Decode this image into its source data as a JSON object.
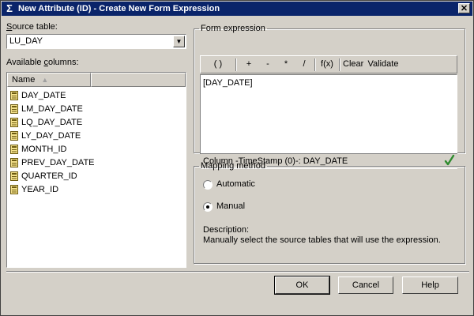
{
  "window": {
    "title": "New Attribute (ID) - Create New Form Expression",
    "icon": "sigma-icon",
    "close_label": "✕"
  },
  "source": {
    "label_prefix": "",
    "label_underline": "S",
    "label_rest": "ource table:",
    "value": "LU_DAY"
  },
  "columns": {
    "label_prefix": "Available ",
    "label_underline": "c",
    "label_rest": "olumns:",
    "header": "Name",
    "items": [
      "DAY_DATE",
      "LM_DAY_DATE",
      "LQ_DAY_DATE",
      "LY_DAY_DATE",
      "MONTH_ID",
      "PREV_DAY_DATE",
      "QUARTER_ID",
      "YEAR_ID"
    ]
  },
  "form_expression": {
    "legend": "Form expression",
    "toolbar": {
      "paren": "( )",
      "plus": "+",
      "minus": "-",
      "multiply": "*",
      "divide": "/",
      "function": "f(x)",
      "clear": "Clear",
      "validate": "Validate"
    },
    "text": "[DAY_DATE]",
    "status": "Column -TimeStamp (0)-: DAY_DATE",
    "valid_color": "#2e8b2e"
  },
  "mapping": {
    "legend": "Mapping method",
    "automatic": "Automatic",
    "manual": "Manual",
    "selected": "manual",
    "description_label": "Description:",
    "description": "Manually select the source tables that will use the expression."
  },
  "buttons": {
    "ok": "OK",
    "cancel": "Cancel",
    "help": "Help"
  }
}
